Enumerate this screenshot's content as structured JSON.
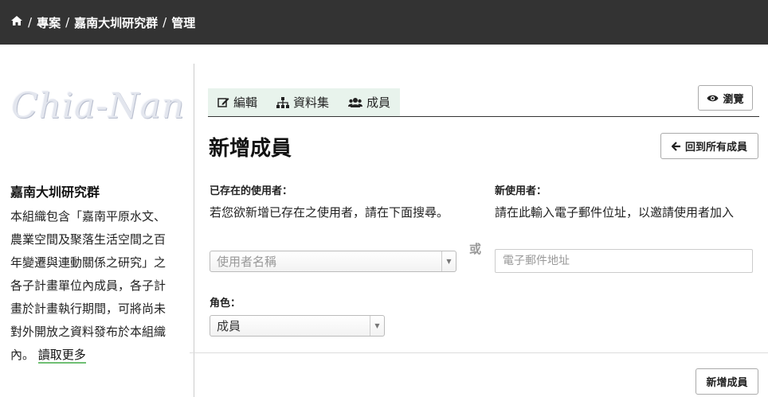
{
  "breadcrumb": {
    "home_icon": "home-icon",
    "items": [
      "專案",
      "嘉南大圳研究群",
      "管理"
    ],
    "separator": "/"
  },
  "sidebar": {
    "logo_text": "Chia-Nan",
    "org_name": "嘉南大圳研究群",
    "description": "本組織包含「嘉南平原水文、農業空間及聚落生活空間之百年變遷與連動關係之研究」之各子計畫單位內成員，各子計畫於計畫執行期間，可將尚未對外開放之資料發布於本組織內。 ",
    "read_more": "讀取更多"
  },
  "tabs": [
    {
      "label": "編輯",
      "icon": "edit-icon"
    },
    {
      "label": "資料集",
      "icon": "sitemap-icon"
    },
    {
      "label": "成員",
      "icon": "group-icon"
    }
  ],
  "view_button": {
    "label": "瀏覽",
    "icon": "eye-icon"
  },
  "page_title": "新增成員",
  "back_button": {
    "label": "回到所有成員",
    "icon": "arrow-left-icon"
  },
  "existing_user": {
    "label": "已存在的使用者：",
    "help": "若您欲新增已存在之使用者，請在下面搜尋。",
    "placeholder": "使用者名稱"
  },
  "or_text": "或",
  "new_user": {
    "label": "新使用者：",
    "help": "請在此輸入電子郵件位址，以邀請使用者加入",
    "placeholder": "電子郵件地址"
  },
  "role": {
    "label": "角色：",
    "selected": "成員"
  },
  "submit_button": {
    "label": "新增成員"
  },
  "colors": {
    "topbar": "#333333",
    "tab_bg": "#e8f3ec",
    "link_underline": "#6fbf73"
  }
}
